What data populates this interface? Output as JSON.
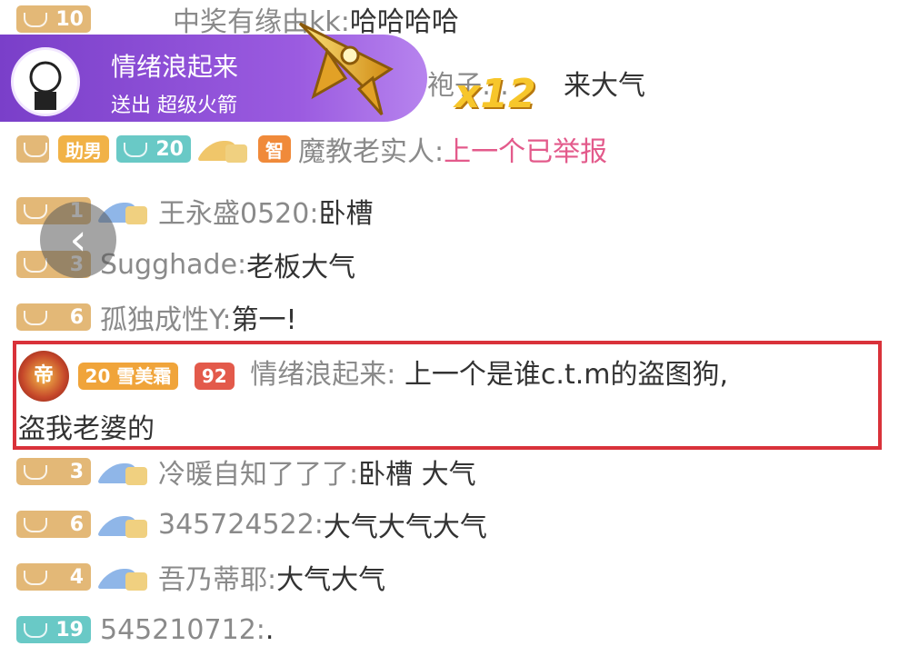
{
  "gift_banner": {
    "sender": "情绪浪起来",
    "action": "送出 超级火箭",
    "combo": "x12"
  },
  "rows": [
    {
      "level": "10",
      "name": "中奖有缘由kk:",
      "msg": "哈哈哈哈"
    },
    {
      "level": "",
      "name": "袍子…",
      "msg": "来大气"
    },
    {
      "level": "20",
      "name": "魔教老实人:",
      "msg": "上一个已举报",
      "badges": [
        "助男"
      ]
    },
    {
      "level": "1",
      "name": "王永盛0520:",
      "msg": "卧槽"
    },
    {
      "level": "3",
      "name": "Sugghade:",
      "msg": "老板大气"
    },
    {
      "level": "6",
      "name": "孤独成性Y:",
      "msg": "第一!"
    },
    {
      "level": "3",
      "name": "冷暖自知了了了:",
      "msg": "卧槽 大气"
    },
    {
      "level": "6",
      "name": "345724522:",
      "msg": "大气大气大气"
    },
    {
      "level": "4",
      "name": "吾乃蒂耶:",
      "msg": "大气大气"
    },
    {
      "level": "19",
      "name": "545210712:",
      "msg": "."
    }
  ],
  "highlight": {
    "badge1": "20 雪美霜",
    "badge2": "92",
    "name": "情绪浪起来:",
    "msg_line1": "上一个是谁c.t.m的盗图狗,",
    "msg_line2": "盗我老婆的",
    "icon": "emperor-crest-icon"
  },
  "icons": {
    "back": "chevron-left-icon"
  },
  "colors": {
    "highlight_border": "#d9323a",
    "gift_bg": "#8e50d8"
  }
}
